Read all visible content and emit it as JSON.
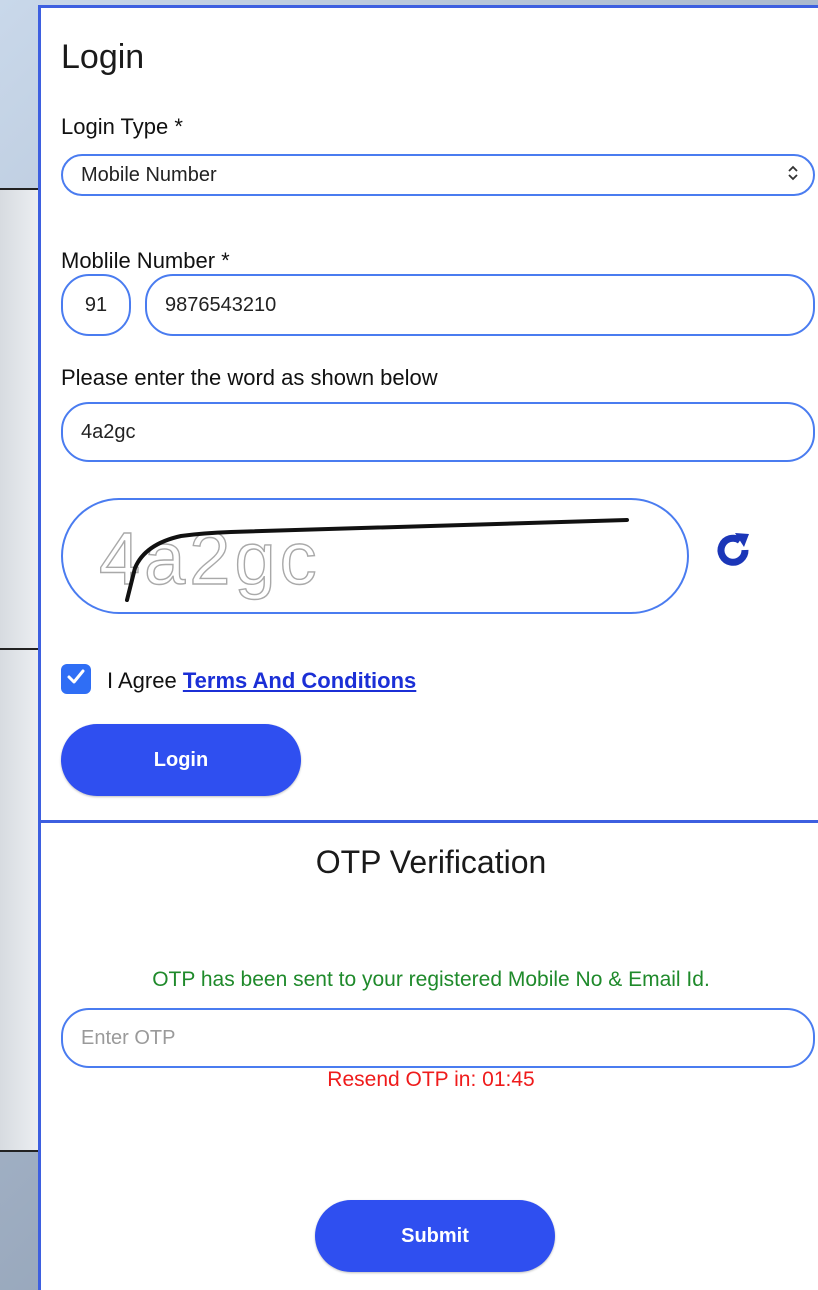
{
  "login": {
    "title": "Login",
    "login_type_label": "Login Type *",
    "login_type_value": "Mobile Number",
    "mobile_label": "Moblile Number *",
    "country_code": "91",
    "mobile_value": "9876543210",
    "captcha_label": "Please enter the word as shown below",
    "captcha_input_value": "4a2gc",
    "captcha_text": "4a2gc",
    "agree_text": "I Agree",
    "terms_link": "Terms And Conditions",
    "terms_checked": true,
    "login_button": "Login"
  },
  "otp": {
    "title": "OTP Verification",
    "message": "OTP has been sent to your registered Mobile No & Email Id.",
    "input_placeholder": "Enter OTP",
    "resend_text": "Resend OTP in: 01:45",
    "submit_button": "Submit"
  },
  "colors": {
    "accent": "#3d5fe0",
    "button": "#2f4ff0",
    "success": "#1f8a2b",
    "error": "#ef1b1b",
    "link": "#1b2fd6"
  },
  "icons": {
    "select": "chevron-up-down-icon",
    "refresh": "refresh-icon",
    "checkbox": "checkmark-icon"
  }
}
